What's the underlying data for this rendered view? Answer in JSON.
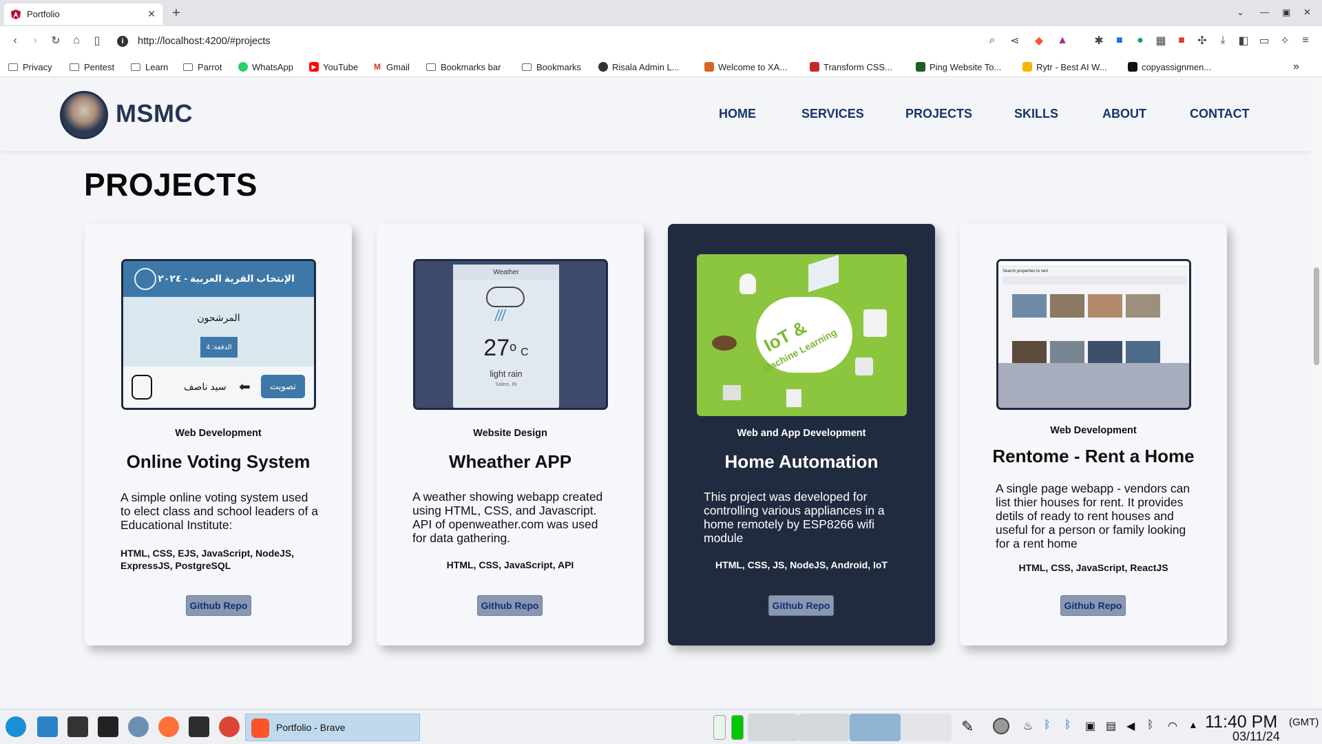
{
  "browser": {
    "tab_title": "Portfolio",
    "url": "http://localhost:4200/#projects",
    "bookmarks": [
      "Privacy",
      "Pentest",
      "Learn",
      "Parrot",
      "WhatsApp",
      "YouTube",
      "Gmail",
      "Bookmarks bar",
      "Bookmarks",
      "Risala Admin L...",
      "Welcome to XA...",
      "Transform CSS...",
      "Ping Website To...",
      "Rytr - Best AI W...",
      "copyassignmen..."
    ]
  },
  "site": {
    "brand": "MSMC",
    "nav": [
      "HOME",
      "SERVICES",
      "PROJECTS",
      "SKILLS",
      "ABOUT",
      "CONTACT"
    ],
    "section_title": "PROJECTS"
  },
  "projects": [
    {
      "category": "Web Development",
      "title": "Online Voting System",
      "description": "A simple online voting system used to elect class and school leaders of a Educational Institute:",
      "tech": "HTML, CSS, EJS, JavaScript, NodeJS, ExpressJS, PostgreSQL",
      "button": "Github Repo",
      "thumb": {
        "header": "الإنتخاب القرية العربية - ٢٠٢٤",
        "subtitle": "المرشحون",
        "batch": "الدفعة: 4",
        "candidate": "سيد ناصف",
        "vote": "تصويت"
      }
    },
    {
      "category": "Website Design",
      "title": "Wheather APP",
      "description": "A weather showing webapp created using HTML, CSS, and Javascript. API of openweather.com was used for data gathering.",
      "tech": "HTML, CSS, JavaScript, API",
      "button": "Github Repo",
      "thumb": {
        "label": "Weather",
        "temp": "27",
        "unit": "o",
        "scale": "C",
        "condition": "light rain",
        "location": "Salem, IN"
      }
    },
    {
      "category": "Web and App Development",
      "title": "Home Automation",
      "description": "This project was developed for controlling various appliances in a home remotely by ESP8266 wifi module",
      "tech": "HTML, CSS, JS, NodeJS, Android, IoT",
      "button": "Github Repo",
      "thumb": {
        "line1": "IoT &",
        "line2": "Machine Learning"
      }
    },
    {
      "category": "Web Development",
      "title": "Rentome - Rent a Home",
      "description": "A single page webapp - vendors can list thier houses for rent. It provides detils of ready to rent houses and useful for a person or family looking for a rent home",
      "tech": "HTML, CSS, JavaScript, ReactJS",
      "button": "Github Repo",
      "thumb": {
        "heading": "Search properties to rent"
      }
    }
  ],
  "taskbar": {
    "task_label": "Portfolio - Brave",
    "time": "11:40 PM",
    "tz": "(GMT)",
    "date": "03/11/24"
  },
  "colors": {
    "accent_blue": "#17346b",
    "dark_card": "#212b3f",
    "button_bg": "#8a97b0",
    "iot_green": "#8cc63f"
  }
}
